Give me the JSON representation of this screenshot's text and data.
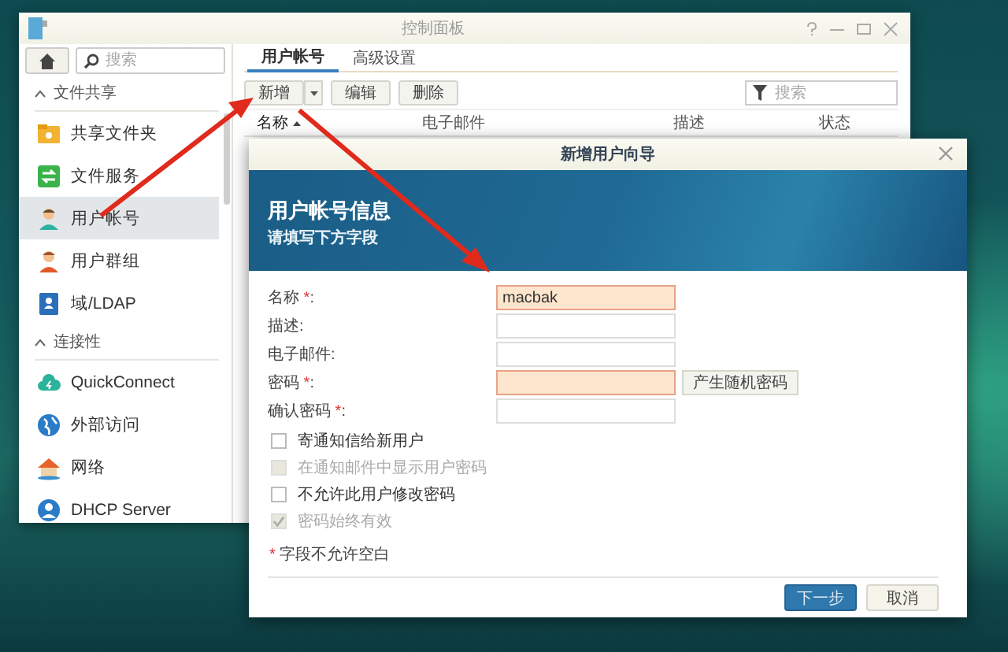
{
  "window": {
    "title": "控制面板"
  },
  "sidebar": {
    "search": {
      "placeholder": "搜索"
    },
    "sections": [
      {
        "label": "文件共享",
        "expanded": true,
        "items": [
          {
            "label": "共享文件夹",
            "selected": false
          },
          {
            "label": "文件服务",
            "selected": false
          },
          {
            "label": "用户帐号",
            "selected": true
          },
          {
            "label": "用户群组",
            "selected": false
          },
          {
            "label": "域/LDAP",
            "selected": false
          }
        ]
      },
      {
        "label": "连接性",
        "expanded": true,
        "items": [
          {
            "label": "QuickConnect",
            "selected": false
          },
          {
            "label": "外部访问",
            "selected": false
          },
          {
            "label": "网络",
            "selected": false
          },
          {
            "label": "DHCP Server",
            "selected": false
          }
        ]
      }
    ]
  },
  "tabs": [
    {
      "label": "用户帐号",
      "selected": true
    },
    {
      "label": "高级设置",
      "selected": false
    }
  ],
  "toolbar": {
    "buttons": [
      "新增",
      "编辑",
      "删除"
    ],
    "search": {
      "placeholder": "搜索"
    }
  },
  "table": {
    "columns": [
      {
        "label": "名称",
        "sorted": true
      },
      {
        "label": "电子邮件",
        "sorted": false
      },
      {
        "label": "描述",
        "sorted": false
      },
      {
        "label": "状态",
        "sorted": false
      }
    ]
  },
  "dialog": {
    "title": "新增用户向导",
    "banner": {
      "title": "用户帐号信息",
      "subtitle": "请填写下方字段"
    },
    "fields": [
      {
        "label": "名称",
        "mark": "*",
        "suffix": ":",
        "value": "macbak",
        "highlighted": true
      },
      {
        "label": "描述:",
        "highlighted": false
      },
      {
        "label": "电子邮件:",
        "highlighted": false
      },
      {
        "label": "密码",
        "mark": "*",
        "suffix": ":",
        "highlighted": true,
        "button": "产生随机密码"
      },
      {
        "label": "确认密码",
        "mark": "*",
        "suffix": ":",
        "highlighted": false
      }
    ],
    "checkboxes": [
      {
        "label": "寄通知信给新用户",
        "checked": false,
        "disabled": false
      },
      {
        "label": "在通知邮件中显示用户密码",
        "checked": false,
        "disabled": true
      },
      {
        "label": "不允许此用户修改密码",
        "checked": false,
        "disabled": false
      },
      {
        "label": "密码始终有效",
        "checked": true,
        "disabled": true
      }
    ],
    "note": {
      "mark": "*",
      "text": "字段不允许空白"
    },
    "buttons": [
      {
        "label": "下一步",
        "kind": "primary"
      },
      {
        "label": "取消",
        "kind": "secondary"
      }
    ]
  }
}
